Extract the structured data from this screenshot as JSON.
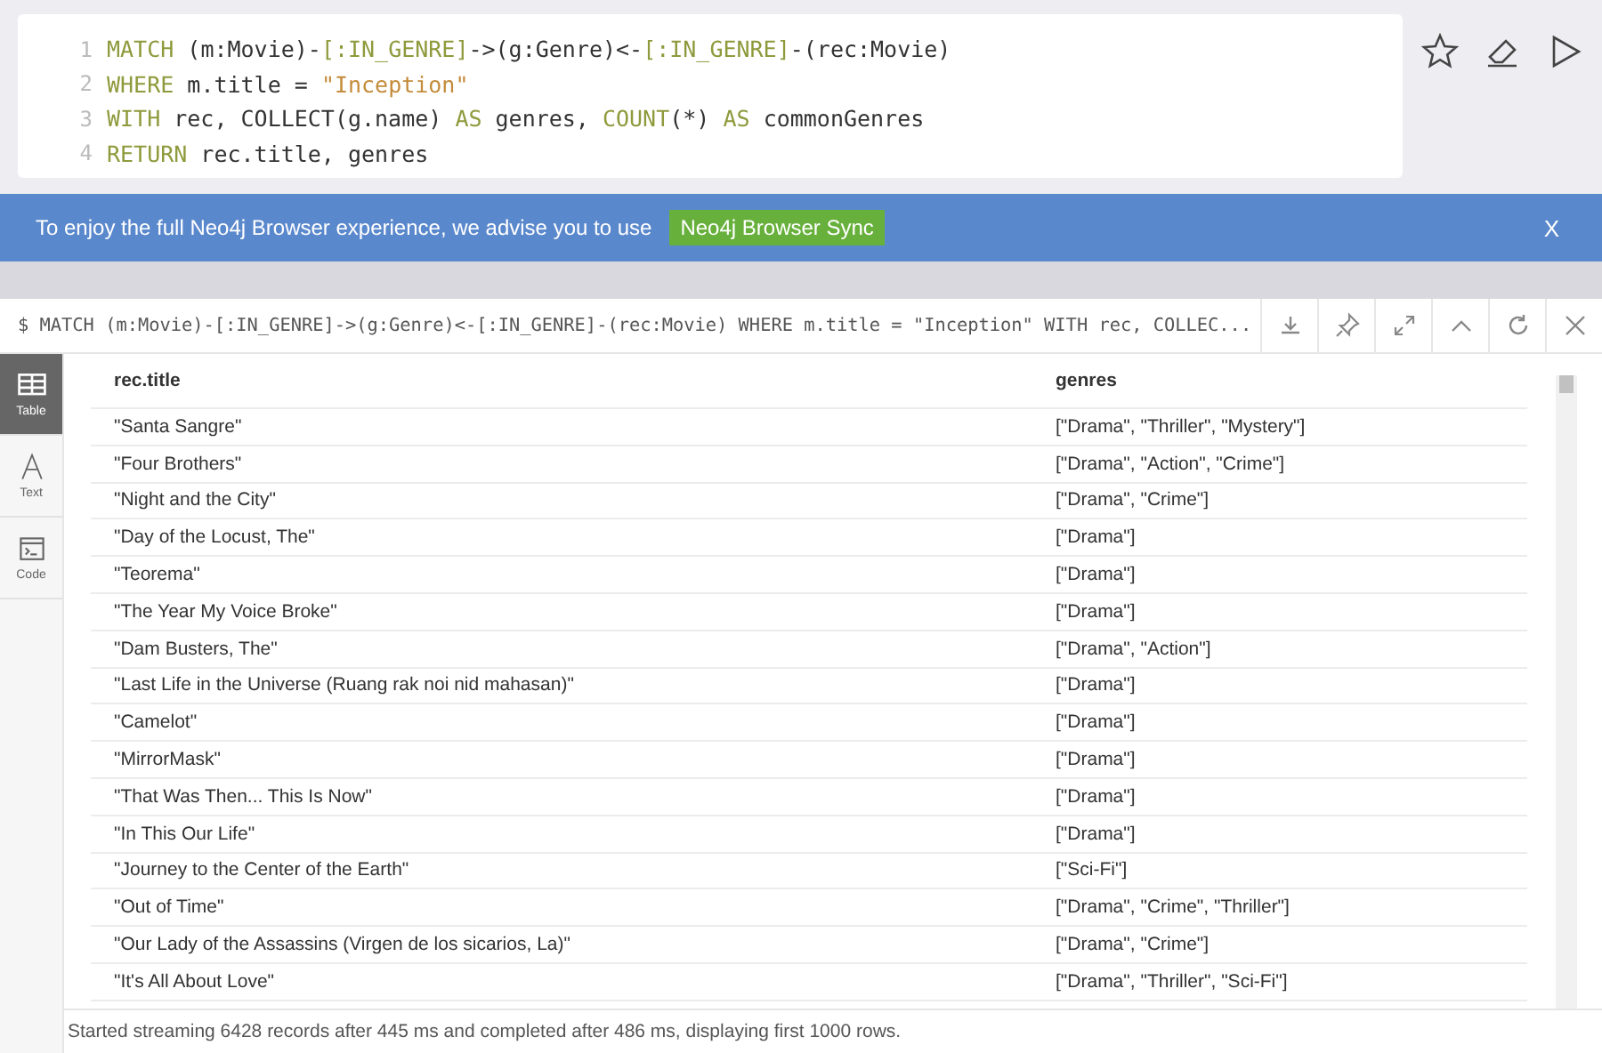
{
  "editor": {
    "lines": [
      {
        "number": "1",
        "tokens": [
          {
            "kind": "keyword",
            "text": "MATCH"
          },
          {
            "kind": "plain",
            "text": " (m:Movie)-"
          },
          {
            "kind": "keyword",
            "text": "[:IN_GENRE]"
          },
          {
            "kind": "plain",
            "text": "->(g:Genre)<-"
          },
          {
            "kind": "keyword",
            "text": "[:IN_GENRE]"
          },
          {
            "kind": "plain",
            "text": "-(rec:Movie)"
          }
        ]
      },
      {
        "number": "2",
        "tokens": [
          {
            "kind": "keyword",
            "text": "WHERE"
          },
          {
            "kind": "plain",
            "text": " m.title = "
          },
          {
            "kind": "string",
            "text": "\"Inception\""
          }
        ]
      },
      {
        "number": "3",
        "tokens": [
          {
            "kind": "keyword",
            "text": "WITH"
          },
          {
            "kind": "plain",
            "text": " rec, COLLECT(g.name) "
          },
          {
            "kind": "keyword",
            "text": "AS"
          },
          {
            "kind": "plain",
            "text": " genres, "
          },
          {
            "kind": "keyword",
            "text": "COUNT"
          },
          {
            "kind": "plain",
            "text": "(*) "
          },
          {
            "kind": "keyword",
            "text": "AS"
          },
          {
            "kind": "plain",
            "text": " commonGenres"
          }
        ]
      },
      {
        "number": "4",
        "tokens": [
          {
            "kind": "keyword",
            "text": "RETURN"
          },
          {
            "kind": "plain",
            "text": " rec.title, genres"
          }
        ]
      }
    ]
  },
  "banner": {
    "text": "To enjoy the full Neo4j Browser experience, we advise you to use",
    "button": "Neo4j Browser Sync",
    "close": "X"
  },
  "result": {
    "query": "$ MATCH (m:Movie)-[:IN_GENRE]->(g:Genre)<-[:IN_GENRE]-(rec:Movie) WHERE m.title = \"Inception\" WITH rec, COLLEC...",
    "view_tabs": [
      {
        "label": "Table",
        "kind": "table",
        "selected": true
      },
      {
        "label": "Text",
        "kind": "text",
        "selected": false
      },
      {
        "label": "Code",
        "kind": "code",
        "selected": false
      }
    ],
    "table": {
      "columns": [
        "rec.title",
        "genres"
      ],
      "rows": [
        [
          "\"Santa Sangre\"",
          "[\"Drama\", \"Thriller\", \"Mystery\"]"
        ],
        [
          "\"Four Brothers\"",
          "[\"Drama\", \"Action\", \"Crime\"]"
        ],
        [
          "\"Night and the City\"",
          "[\"Drama\", \"Crime\"]"
        ],
        [
          "\"Day of the Locust, The\"",
          "[\"Drama\"]"
        ],
        [
          "\"Teorema\"",
          "[\"Drama\"]"
        ],
        [
          "\"The Year My Voice Broke\"",
          "[\"Drama\"]"
        ],
        [
          "\"Dam Busters, The\"",
          "[\"Drama\", \"Action\"]"
        ],
        [
          "\"Last Life in the Universe (Ruang rak noi nid mahasan)\"",
          "[\"Drama\"]"
        ],
        [
          "\"Camelot\"",
          "[\"Drama\"]"
        ],
        [
          "\"MirrorMask\"",
          "[\"Drama\"]"
        ],
        [
          "\"That Was Then... This Is Now\"",
          "[\"Drama\"]"
        ],
        [
          "\"In This Our Life\"",
          "[\"Drama\"]"
        ],
        [
          "\"Journey to the Center of the Earth\"",
          "[\"Sci-Fi\"]"
        ],
        [
          "\"Out of Time\"",
          "[\"Drama\", \"Crime\", \"Thriller\"]"
        ],
        [
          "\"Our Lady of the Assassins (Virgen de los sicarios, La)\"",
          "[\"Drama\", \"Crime\"]"
        ],
        [
          "\"It's All About Love\"",
          "[\"Drama\", \"Thriller\", \"Sci-Fi\"]"
        ]
      ]
    },
    "status": "Started streaming 6428 records after 445 ms and completed after 486 ms, displaying first 1000 rows."
  }
}
